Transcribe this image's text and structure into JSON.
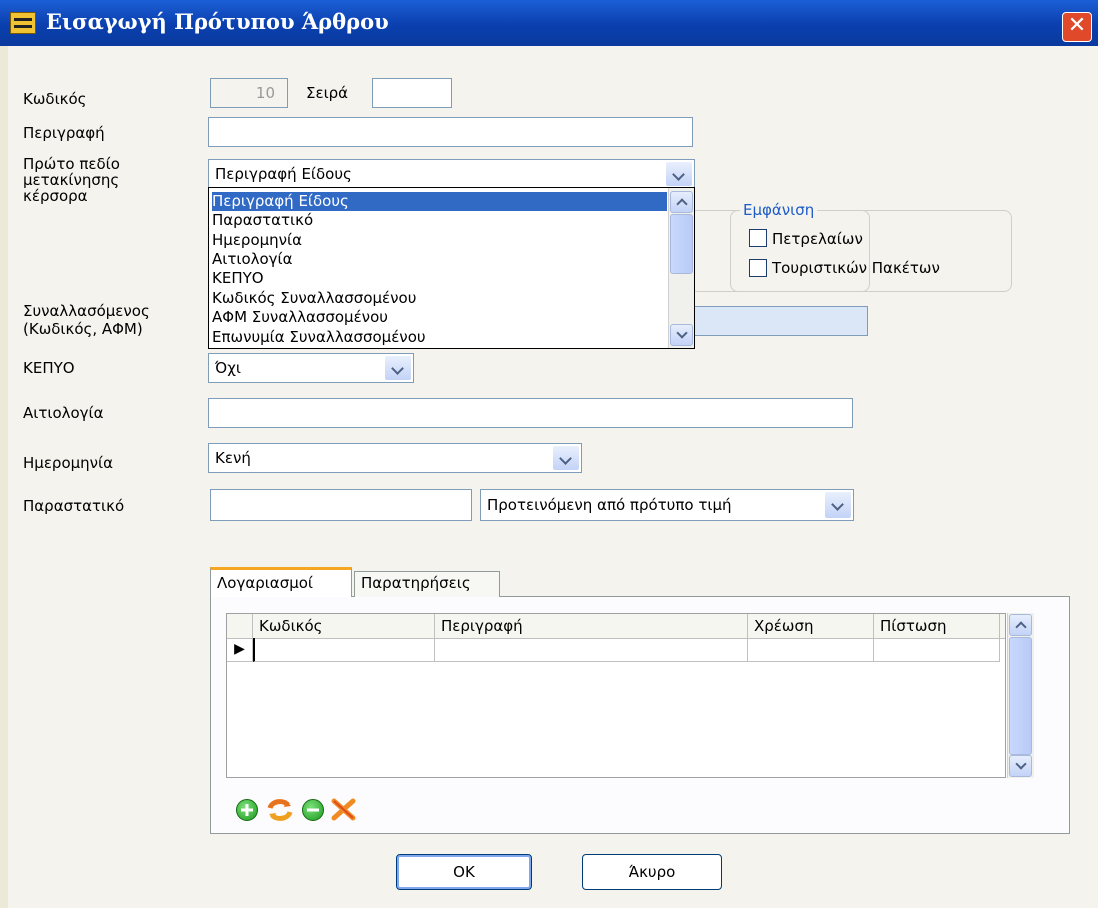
{
  "window": {
    "title": "Εισαγωγή Πρότυπου Άρθρου",
    "close_glyph": "✕"
  },
  "form": {
    "code_label": "Κωδικός",
    "code_value": "10",
    "order_label": "Σειρά",
    "order_value": "",
    "description_label": "Περιγραφή",
    "description_value": "",
    "first_field_label": "Πρώτο πεδίο μετακίνησης κέρσορα",
    "first_field_value": "Περιγραφή Είδους",
    "first_field_options": [
      "Περιγραφή Είδους",
      "Παραστατικό",
      "Ημερομηνία",
      "Αιτιολογία",
      "ΚΕΠΥΟ",
      "Κωδικός Συναλλασσομένου",
      "ΑΦΜ Συναλλασσομένου",
      "Επωνυμία Συναλλασσομένου"
    ],
    "counterparty_label": "Συναλλασόμενος (Κωδικός, ΑΦΜ)",
    "kepyo_label": "ΚΕΠΥΟ",
    "kepyo_value": "Όχι",
    "justification_label": "Αιτιολογία",
    "justification_value": "",
    "date_label": "Ημερομηνία",
    "date_value": "Κενή",
    "document_label": "Παραστατικό",
    "document_value": "",
    "document_mode_value": "Προτεινόμενη από πρότυπο τιμή"
  },
  "display_group": {
    "title": "Εμφάνιση",
    "petroleum_label": "Πετρελαίων",
    "petroleum_checked": false,
    "tourist_label": "Τουριστικών Πακέτων",
    "tourist_checked": false
  },
  "tabs": [
    {
      "label": "Λογαριασμοί",
      "active": true
    },
    {
      "label": "Παρατηρήσεις",
      "active": false
    }
  ],
  "grid": {
    "columns": [
      "Κωδικός",
      "Περιγραφή",
      "Χρέωση",
      "Πίστωση"
    ],
    "current_row_indicator": "▶"
  },
  "toolbar": {
    "add": "add-icon",
    "refresh": "refresh-icon",
    "remove": "remove-icon",
    "delete": "delete-icon"
  },
  "buttons": {
    "ok": "ΟΚ",
    "cancel": "Άκυρο"
  },
  "colors": {
    "titlebar": "#0a3fae",
    "selection": "#316ac5",
    "group_title": "#1f5cc5",
    "readonly_bg": "#dbe6f7"
  }
}
